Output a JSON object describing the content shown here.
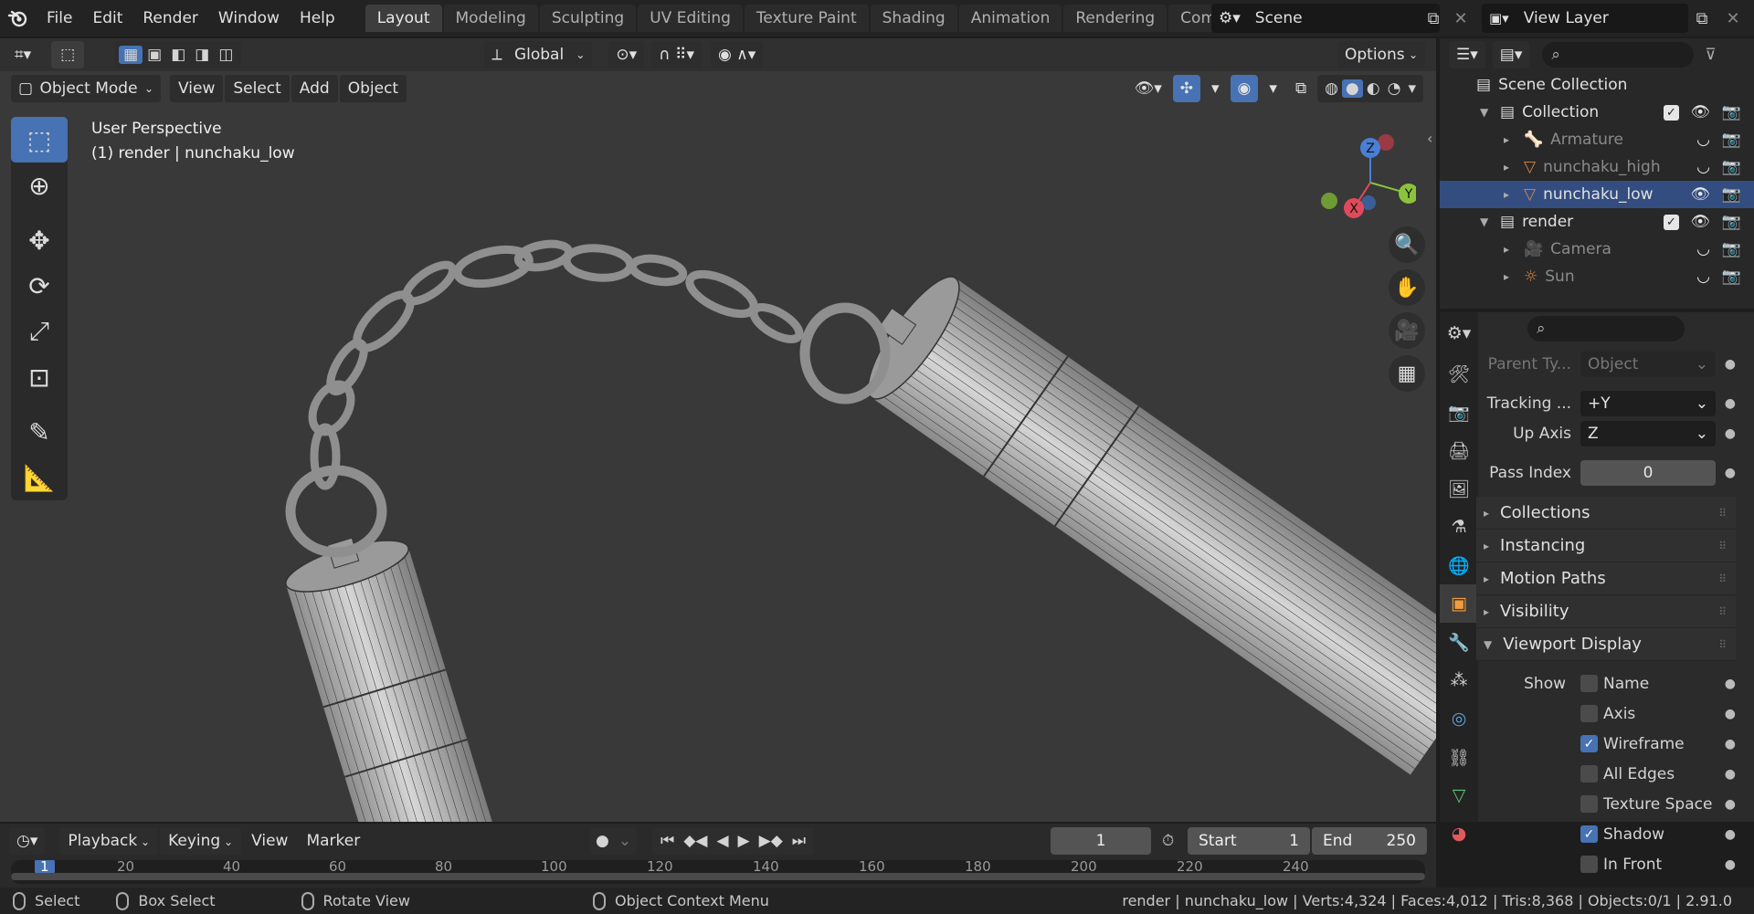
{
  "menu": [
    "File",
    "Edit",
    "Render",
    "Window",
    "Help"
  ],
  "workspace_tabs": [
    "Layout",
    "Modeling",
    "Sculpting",
    "UV Editing",
    "Texture Paint",
    "Shading",
    "Animation",
    "Rendering",
    "Compos"
  ],
  "active_tab": "Layout",
  "scene_name": "Scene",
  "view_layer": "View Layer",
  "viewport": {
    "transform_orientation": "Global",
    "options_label": "Options",
    "mode": "Object Mode",
    "menus": [
      "View",
      "Select",
      "Add",
      "Object"
    ],
    "info_line1": "User Perspective",
    "info_line2": "(1) render | nunchaku_low",
    "gizmo": {
      "x": "X",
      "y": "Y",
      "z": "Z"
    }
  },
  "outliner": {
    "rows": [
      {
        "label": "Scene Collection",
        "indent": 0
      },
      {
        "label": "Collection",
        "indent": 1,
        "check": true
      },
      {
        "label": "Armature",
        "indent": 2,
        "dim": true
      },
      {
        "label": "nunchaku_high",
        "indent": 2,
        "dim": true
      },
      {
        "label": "nunchaku_low",
        "indent": 2,
        "selected": true
      },
      {
        "label": "render",
        "indent": 1,
        "check": true
      },
      {
        "label": "Camera",
        "indent": 2,
        "dim": true
      },
      {
        "label": "Sun",
        "indent": 2,
        "dim": true
      }
    ]
  },
  "properties": {
    "parent_type_label": "Parent Ty...",
    "parent_type_value": "Object",
    "tracking_label": "Tracking ...",
    "tracking_value": "+Y",
    "up_axis_label": "Up Axis",
    "up_axis_value": "Z",
    "pass_index_label": "Pass Index",
    "pass_index_value": "0",
    "panels": [
      "Collections",
      "Instancing",
      "Motion Paths",
      "Visibility",
      "Viewport Display"
    ],
    "show_label": "Show",
    "checks": [
      {
        "label": "Name",
        "on": false
      },
      {
        "label": "Axis",
        "on": false
      },
      {
        "label": "Wireframe",
        "on": true
      },
      {
        "label": "All Edges",
        "on": false
      },
      {
        "label": "Texture Space",
        "on": false
      },
      {
        "label": "Shadow",
        "on": true
      },
      {
        "label": "In Front",
        "on": false
      }
    ]
  },
  "timeline": {
    "menus": [
      "Playback",
      "Keying",
      "View",
      "Marker"
    ],
    "current_frame": "1",
    "start_label": "Start",
    "start_value": "1",
    "end_label": "End",
    "end_value": "250",
    "ruler": [
      "1",
      "20",
      "40",
      "60",
      "80",
      "100",
      "120",
      "140",
      "160",
      "180",
      "200",
      "220",
      "240"
    ]
  },
  "status": {
    "select": "Select",
    "box_select": "Box Select",
    "rotate_view": "Rotate View",
    "context_menu": "Object Context Menu",
    "stats": "render | nunchaku_low | Verts:4,324 | Faces:4,012 | Tris:8,368 | Objects:0/1 | 2.91.0"
  }
}
